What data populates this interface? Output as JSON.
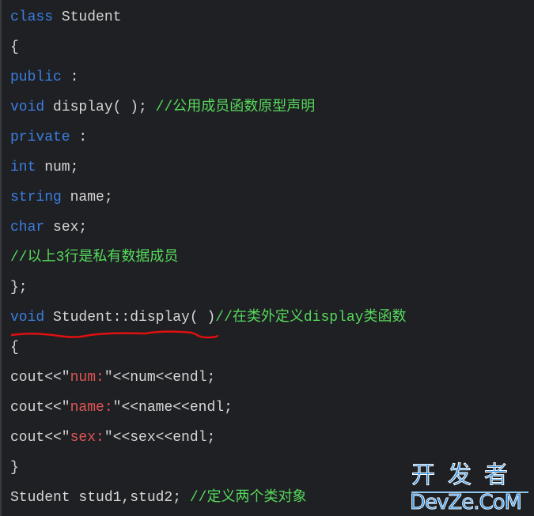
{
  "code": {
    "lines": [
      {
        "tokens": [
          {
            "t": "class",
            "c": "kw"
          },
          {
            "t": " Student",
            "c": "plain"
          }
        ]
      },
      {
        "tokens": [
          {
            "t": "{",
            "c": "plain"
          }
        ]
      },
      {
        "tokens": [
          {
            "t": "public",
            "c": "kw"
          },
          {
            "t": " :",
            "c": "plain"
          }
        ]
      },
      {
        "tokens": [
          {
            "t": "void",
            "c": "kw"
          },
          {
            "t": " display( ); ",
            "c": "plain"
          },
          {
            "t": "//公用成员函数原型声明",
            "c": "comment"
          }
        ]
      },
      {
        "tokens": [
          {
            "t": "private",
            "c": "kw"
          },
          {
            "t": " :",
            "c": "plain"
          }
        ]
      },
      {
        "tokens": [
          {
            "t": "int",
            "c": "kw"
          },
          {
            "t": " num;",
            "c": "plain"
          }
        ]
      },
      {
        "tokens": [
          {
            "t": "string",
            "c": "kw"
          },
          {
            "t": " name;",
            "c": "plain"
          }
        ]
      },
      {
        "tokens": [
          {
            "t": "char",
            "c": "kw"
          },
          {
            "t": " sex;",
            "c": "plain"
          }
        ]
      },
      {
        "tokens": [
          {
            "t": "//以上3行是私有数据成员",
            "c": "comment"
          }
        ]
      },
      {
        "tokens": [
          {
            "t": "};",
            "c": "plain"
          }
        ]
      },
      {
        "tokens": [
          {
            "t": "void",
            "c": "kw"
          },
          {
            "t": " Student::display( )",
            "c": "plain"
          },
          {
            "t": "//在类外定义display类函数",
            "c": "comment"
          }
        ]
      },
      {
        "tokens": [
          {
            "t": "{",
            "c": "plain"
          }
        ]
      },
      {
        "tokens": [
          {
            "t": "cout<<\"",
            "c": "plain"
          },
          {
            "t": "num:",
            "c": "str"
          },
          {
            "t": "\"<<num<<endl;",
            "c": "plain"
          }
        ]
      },
      {
        "tokens": [
          {
            "t": "cout<<\"",
            "c": "plain"
          },
          {
            "t": "name:",
            "c": "str"
          },
          {
            "t": "\"<<name<<endl;",
            "c": "plain"
          }
        ]
      },
      {
        "tokens": [
          {
            "t": "cout<<\"",
            "c": "plain"
          },
          {
            "t": "sex:",
            "c": "str"
          },
          {
            "t": "\"<<sex<<endl;",
            "c": "plain"
          }
        ]
      },
      {
        "tokens": [
          {
            "t": "}",
            "c": "plain"
          }
        ]
      },
      {
        "tokens": [
          {
            "t": "Student stud1,stud2; ",
            "c": "plain"
          },
          {
            "t": "//定义两个类对象",
            "c": "comment"
          }
        ]
      }
    ]
  },
  "annotation": {
    "underline_color": "#e01010",
    "target_text": "void Student::display( )"
  },
  "watermark": {
    "chinese": "开发者",
    "english": "DevZe.CoM"
  },
  "colors": {
    "background": "#1f2023",
    "keyword": "#3b7de0",
    "comment": "#56d95c",
    "string": "#e05555",
    "text": "#d6d6d6"
  }
}
